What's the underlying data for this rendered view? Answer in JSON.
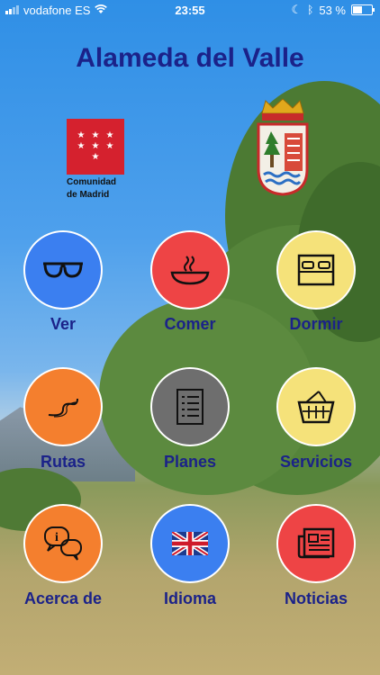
{
  "status_bar": {
    "carrier": "vodafone ES",
    "time": "23:55",
    "battery": "53 %",
    "battery_level": 0.53
  },
  "header": {
    "title": "Alameda del Valle"
  },
  "logos": {
    "madrid_line1": "Comunidad",
    "madrid_line2": "de Madrid"
  },
  "menu": [
    {
      "label": "Ver",
      "color": "#3b7ff0",
      "icon": "glasses-icon"
    },
    {
      "label": "Comer",
      "color": "#ee4445",
      "icon": "food-bowl-icon"
    },
    {
      "label": "Dormir",
      "color": "#f5e27a",
      "icon": "bed-icon"
    },
    {
      "label": "Rutas",
      "color": "#f47f2e",
      "icon": "route-icon"
    },
    {
      "label": "Planes",
      "color": "#6e6e6e",
      "icon": "checklist-icon"
    },
    {
      "label": "Servicios",
      "color": "#f5e27a",
      "icon": "basket-icon"
    },
    {
      "label": "Acerca de",
      "color": "#f47f2e",
      "icon": "info-chat-icon"
    },
    {
      "label": "Idioma",
      "color": "#3b7ff0",
      "icon": "uk-flag-icon"
    },
    {
      "label": "Noticias",
      "color": "#ee4445",
      "icon": "newspaper-icon"
    }
  ]
}
